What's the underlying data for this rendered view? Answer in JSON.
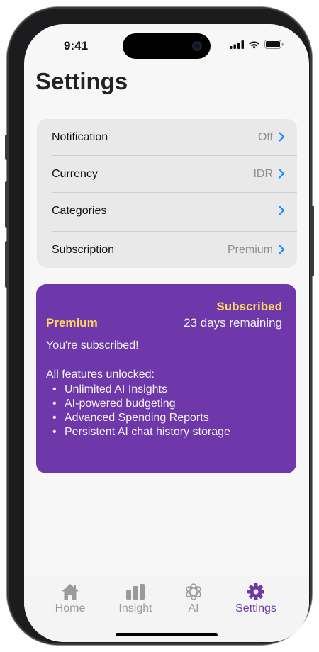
{
  "status_bar": {
    "time": "9:41"
  },
  "page": {
    "title": "Settings"
  },
  "settings": {
    "rows": [
      {
        "label": "Notification",
        "value": "Off"
      },
      {
        "label": "Currency",
        "value": "IDR"
      },
      {
        "label": "Categories",
        "value": ""
      },
      {
        "label": "Subscription",
        "value": "Premium"
      }
    ]
  },
  "subscription_card": {
    "status": "Subscribed",
    "plan": "Premium",
    "remaining": "23 days remaining",
    "message": "You're subscribed!",
    "features_title": "All features unlocked:",
    "features": [
      "Unlimited AI Insights",
      "AI-powered budgeting",
      "Advanced Spending Reports",
      "Persistent AI chat history storage"
    ]
  },
  "tabs": [
    {
      "label": "Home",
      "icon": "house-icon",
      "active": false
    },
    {
      "label": "Insight",
      "icon": "bar-chart-icon",
      "active": false
    },
    {
      "label": "AI",
      "icon": "ai-icon",
      "active": false
    },
    {
      "label": "Settings",
      "icon": "gear-icon",
      "active": true
    }
  ],
  "colors": {
    "accent": "#6e38aa",
    "highlight": "#ffd75e",
    "chevron": "#1a8cff",
    "inactive_tab": "#9a9a9a"
  }
}
